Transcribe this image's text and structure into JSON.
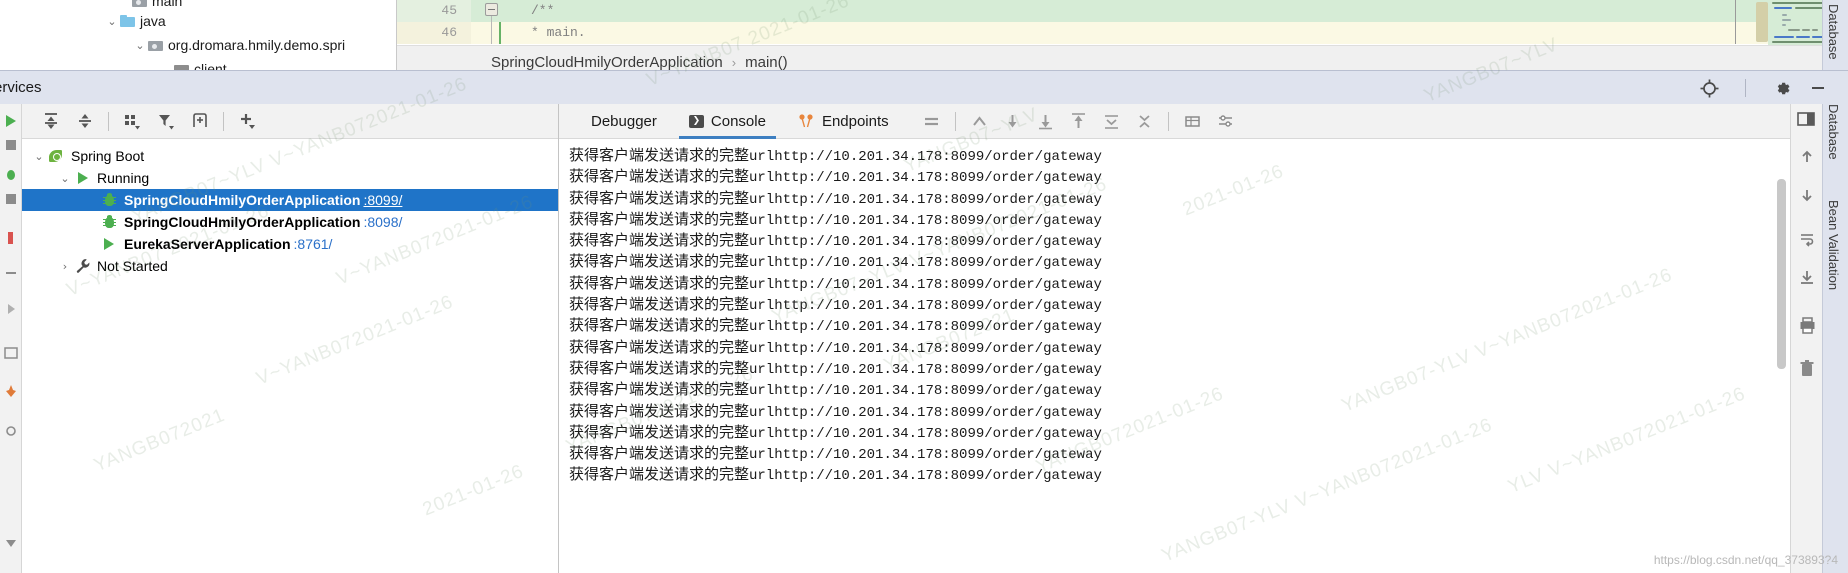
{
  "project_tree": {
    "rows": [
      {
        "chevron": "",
        "icon": "folder-gray-icon",
        "label": "main"
      },
      {
        "chevron": "⌄",
        "icon": "folder-blue-icon",
        "label": "java"
      },
      {
        "chevron": "⌄",
        "icon": "folder-package-icon",
        "label": "org.dromara.hmily.demo.spri"
      },
      {
        "chevron": "⌄",
        "icon": "folder-plain-icon",
        "label": "client"
      }
    ]
  },
  "editor": {
    "lines": [
      {
        "number": "45",
        "text": "/**",
        "italic": false
      },
      {
        "number": "46",
        "text": "* main.",
        "italic": true
      }
    ],
    "breadcrumb": {
      "class_name": "SpringCloudHmilyOrderApplication",
      "separator": "›",
      "method_name": "main()"
    }
  },
  "services_titlebar": {
    "title": "ervices",
    "actions": [
      {
        "name": "locate-icon",
        "tooltip": "Locate"
      },
      {
        "name": "gear-icon",
        "tooltip": "Settings"
      },
      {
        "name": "minimize-icon",
        "tooltip": "Hide"
      }
    ]
  },
  "services_toolbar": {
    "buttons": [
      {
        "name": "expand-all-icon",
        "label": "Expand All"
      },
      {
        "name": "collapse-all-icon",
        "label": "Collapse All"
      },
      {
        "name": "group-by-icon",
        "label": "Group By"
      },
      {
        "name": "filter-icon",
        "label": "Filter"
      },
      {
        "name": "add-tab-icon",
        "label": "Open in New Tab"
      },
      {
        "name": "add-service-icon",
        "label": "Add Service"
      }
    ]
  },
  "services_tree": {
    "rows": [
      {
        "indent": 0,
        "chevron": "⌄",
        "icon": "spring-boot-icon",
        "name": "Spring Boot",
        "port": "",
        "selected": false,
        "bold": false
      },
      {
        "indent": 1,
        "chevron": "⌄",
        "icon": "run-play-icon",
        "name": "Running",
        "port": "",
        "selected": false,
        "bold": false
      },
      {
        "indent": 2,
        "chevron": "",
        "icon": "debug-bug-icon",
        "name": "SpringCloudHmilyOrderApplication",
        "port": ":8099/",
        "selected": true,
        "bold": true
      },
      {
        "indent": 2,
        "chevron": "",
        "icon": "debug-bug-icon",
        "name": "SpringCloudHmilyOrderApplication",
        "port": ":8098/",
        "selected": false,
        "bold": true
      },
      {
        "indent": 2,
        "chevron": "",
        "icon": "run-play-icon",
        "name": "EurekaServerApplication",
        "port": ":8761/",
        "selected": false,
        "bold": true
      },
      {
        "indent": 1,
        "chevron": "›",
        "icon": "wrench-icon",
        "name": "Not Started",
        "port": "",
        "selected": false,
        "bold": false
      }
    ]
  },
  "console": {
    "tabs": [
      {
        "label": "Debugger",
        "icon": "",
        "active": false
      },
      {
        "label": "Console",
        "icon": "console-icon",
        "active": true
      },
      {
        "label": "Endpoints",
        "icon": "endpoints-icon",
        "active": false
      }
    ],
    "toolbar": [
      {
        "name": "layout-icon",
        "label": "Layout Settings"
      },
      {
        "name": "step-out-icon",
        "label": "Step Out"
      },
      {
        "name": "scroll-down-icon",
        "label": "Scroll to End"
      },
      {
        "name": "soft-wrap-icon",
        "label": "Soft-Wrap"
      },
      {
        "name": "scroll-up-icon",
        "label": "Scroll to Top"
      },
      {
        "name": "fold-icon",
        "label": "Fold Lines"
      },
      {
        "name": "unfold-icon",
        "label": "Unfold Lines"
      },
      {
        "name": "grid-icon",
        "label": "Use Grid"
      },
      {
        "name": "settings-sliders-icon",
        "label": "Console Settings"
      }
    ],
    "log_prefix": "获得客户端发送请求的完整",
    "log_url": "urlhttp://10.201.34.178:8099/order/gateway",
    "log_line_count": 16
  },
  "right_toolbar": {
    "buttons": [
      {
        "name": "arrow-up-icon",
        "label": "Previous"
      },
      {
        "name": "arrow-down-icon",
        "label": "Next"
      },
      {
        "name": "wrap-text-icon",
        "label": "Soft Wrap"
      },
      {
        "name": "export-icon",
        "label": "Export"
      },
      {
        "name": "print-icon",
        "label": "Print"
      },
      {
        "name": "trash-icon",
        "label": "Clear All"
      }
    ],
    "split-screen": {
      "name": "split-screen-icon",
      "label": "Split Screen"
    }
  },
  "side_tabs": {
    "database": "Database",
    "bean_validation": "Bean Validation"
  },
  "watermarks": [
    "YANGB07~YLV  V~YANB072021-01-26",
    "YANGB072021-01-26",
    "V~YANB072021-01-26",
    "YANGB07~YLV",
    "2021-01-26",
    "YANGB07-YLV  V~YANB072021-01-26",
    "V~YANB07 2021-01-26",
    "YANGB072021",
    "YLV V~YANB072021-01-26"
  ],
  "blog_link": "https://blog.csdn.net/qq_373893?4",
  "colors": {
    "selection_blue": "#1f74c8",
    "port_blue": "#2a70c9",
    "spring_green": "#6db33f",
    "tab_underline": "#3d7fc1",
    "titlebar": "#dfe3ee",
    "endpoint_orange": "#e8853c"
  }
}
